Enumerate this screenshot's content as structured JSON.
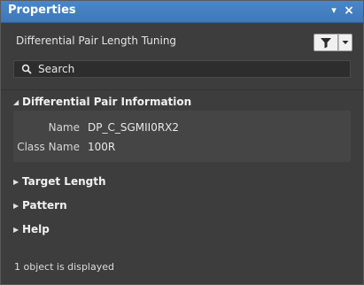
{
  "window": {
    "title": "Properties",
    "pin_glyph": "▾",
    "close_glyph": "×"
  },
  "header": {
    "subtitle": "Differential Pair Length Tuning",
    "filter_icon": "funnel-icon",
    "dropdown_icon": "chevron-down-icon"
  },
  "search": {
    "placeholder": "Search",
    "icon": "search-icon"
  },
  "sections": [
    {
      "label": "Differential Pair Information",
      "expanded": true
    },
    {
      "label": "Target Length",
      "expanded": false
    },
    {
      "label": "Pattern",
      "expanded": false
    },
    {
      "label": "Help",
      "expanded": false
    }
  ],
  "properties": [
    {
      "label": "Name",
      "value": "DP_C_SGMII0RX2"
    },
    {
      "label": "Class Name",
      "value": "100R"
    }
  ],
  "footer": {
    "status": "1 object is displayed"
  },
  "colors": {
    "titlebar": "#3f78b7",
    "panel_bg": "#3d3d3d"
  }
}
